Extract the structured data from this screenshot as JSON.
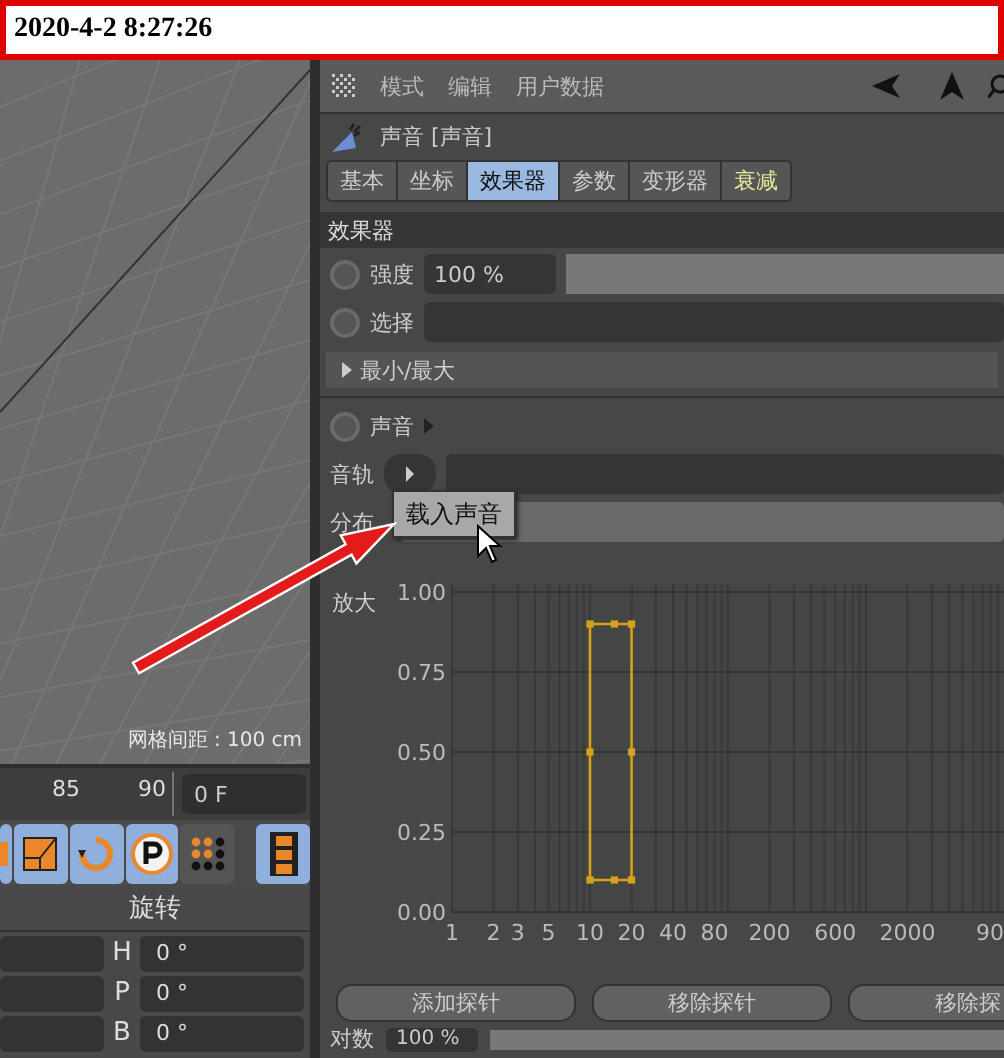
{
  "timestamp": "2020-4-2 8:27:26",
  "viewport": {
    "grid_label": "网格间距 : 100 cm"
  },
  "timeline": {
    "ticks": [
      "85",
      "90"
    ],
    "frame_field": "0 F"
  },
  "toolbar": [
    {
      "kind": "cut",
      "on": true
    },
    {
      "kind": "scale",
      "on": true
    },
    {
      "kind": "rotate",
      "on": true
    },
    {
      "kind": "param",
      "on": true
    },
    {
      "kind": "dots",
      "on": false
    },
    {
      "kind": "film",
      "on": true
    }
  ],
  "coordinates": {
    "header": "旋转",
    "rows": [
      {
        "label": "H",
        "value": "0 °"
      },
      {
        "label": "P",
        "value": "0 °"
      },
      {
        "label": "B",
        "value": "0 °"
      }
    ]
  },
  "attributes": {
    "menu": [
      "模式",
      "编辑",
      "用户数据"
    ],
    "title": "声音 [声音]",
    "tabs": [
      {
        "label": "基本",
        "selected": false,
        "highlighted": false
      },
      {
        "label": "坐标",
        "selected": false,
        "highlighted": false
      },
      {
        "label": "效果器",
        "selected": true,
        "highlighted": false
      },
      {
        "label": "参数",
        "selected": false,
        "highlighted": false
      },
      {
        "label": "变形器",
        "selected": false,
        "highlighted": false
      },
      {
        "label": "衰减",
        "selected": false,
        "highlighted": true
      }
    ],
    "section": "效果器",
    "strength": {
      "label": "强度",
      "value": "100 %",
      "keyframed": false
    },
    "selection": {
      "label": "选择",
      "keyframed": false
    },
    "group": {
      "label": "最小/最大",
      "expanded": false
    },
    "sound": {
      "label": "声音",
      "keyframed": false
    },
    "track": {
      "label": "音轨"
    },
    "distribution": {
      "label": "分布"
    },
    "tooltip": "载入声音",
    "falloff_graph": {
      "ylabel": "放大",
      "y_labels": [
        "1.00",
        "0.75",
        "0.50",
        "0.25",
        "0.00"
      ],
      "x_labels": [
        "1",
        "2",
        "3",
        "5",
        "10",
        "20",
        "40",
        "80",
        "200",
        "600",
        "2000",
        "90"
      ]
    },
    "buttons": [
      "添加探针",
      "移除探针",
      "移除探"
    ],
    "bottom_row": {
      "label": "对数",
      "value": "100 %"
    }
  }
}
